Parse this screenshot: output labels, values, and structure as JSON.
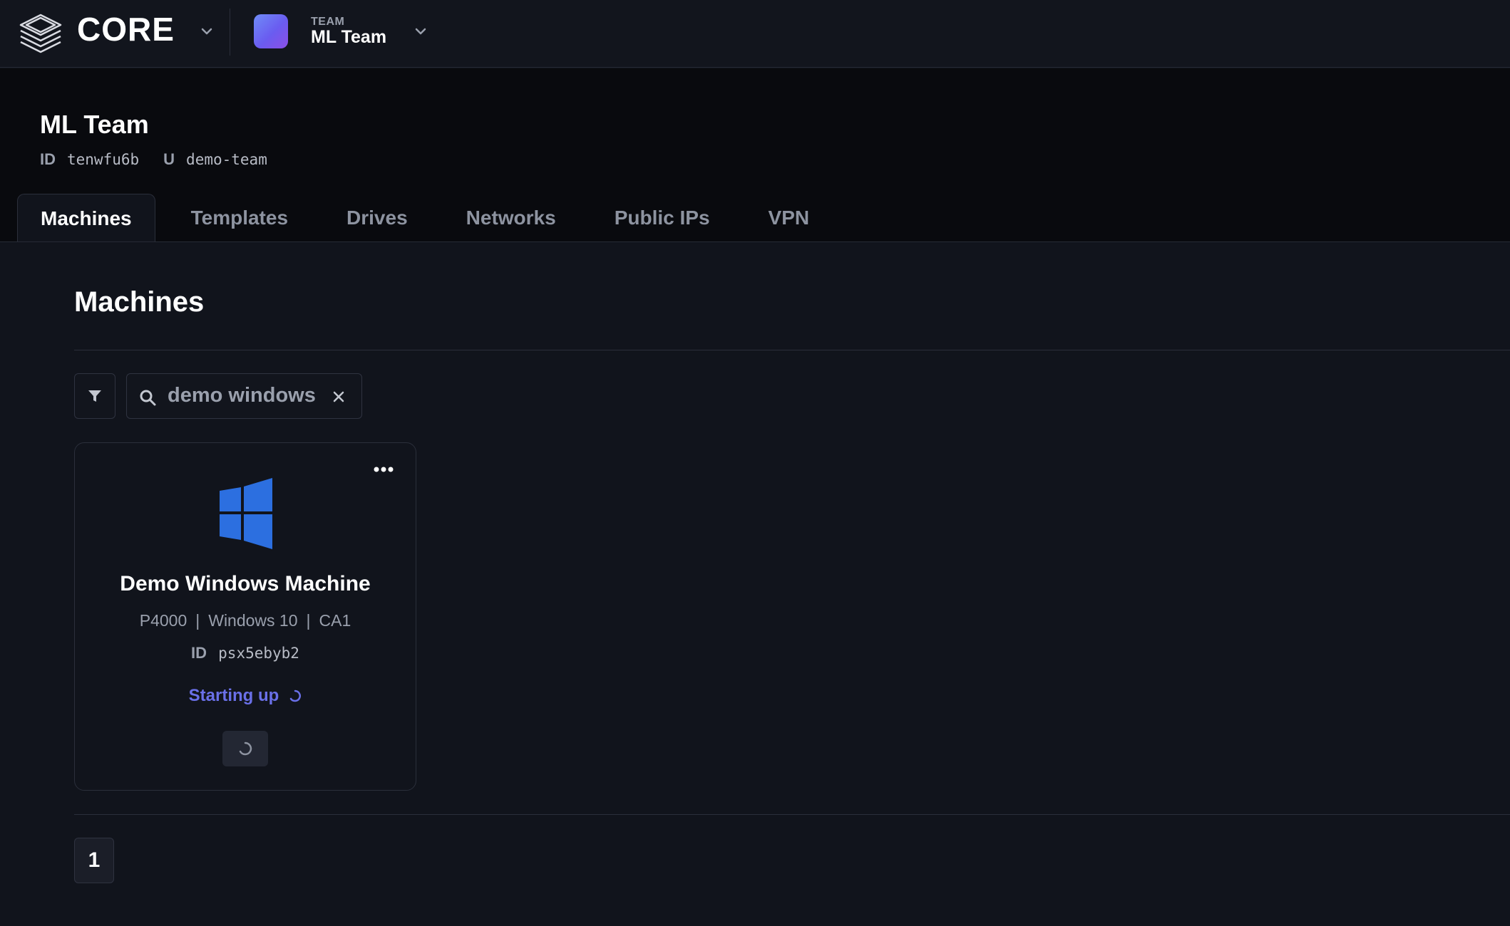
{
  "topbar": {
    "brand": "CORE",
    "team_caption": "TEAM",
    "team_name": "ML Team",
    "icons": [
      "stack-logo-icon",
      "chevron-down-icon"
    ]
  },
  "header": {
    "title": "ML Team",
    "id_key": "ID",
    "id_value": "tenwfu6b",
    "slug_key": "U",
    "slug_value": "demo-team"
  },
  "tabs": [
    {
      "label": "Machines",
      "active": true
    },
    {
      "label": "Templates",
      "active": false
    },
    {
      "label": "Drives",
      "active": false
    },
    {
      "label": "Networks",
      "active": false
    },
    {
      "label": "Public IPs",
      "active": false
    },
    {
      "label": "VPN",
      "active": false
    }
  ],
  "section": {
    "title": "Machines"
  },
  "search": {
    "value": "demo windows"
  },
  "machines": [
    {
      "name": "Demo Windows Machine",
      "gpu": "P4000",
      "os": "Windows 10",
      "region": "CA1",
      "id_key": "ID",
      "id": "psx5ebyb2",
      "status": "Starting up",
      "os_icon": "windows-logo-icon"
    }
  ],
  "specs_separator": "|",
  "pagination": {
    "current_page": "1"
  },
  "colors": {
    "background": "#11141c",
    "header_band": "#090a0e",
    "status_accent": "#6a70e8",
    "windows_blue": "#2c6fe0"
  }
}
